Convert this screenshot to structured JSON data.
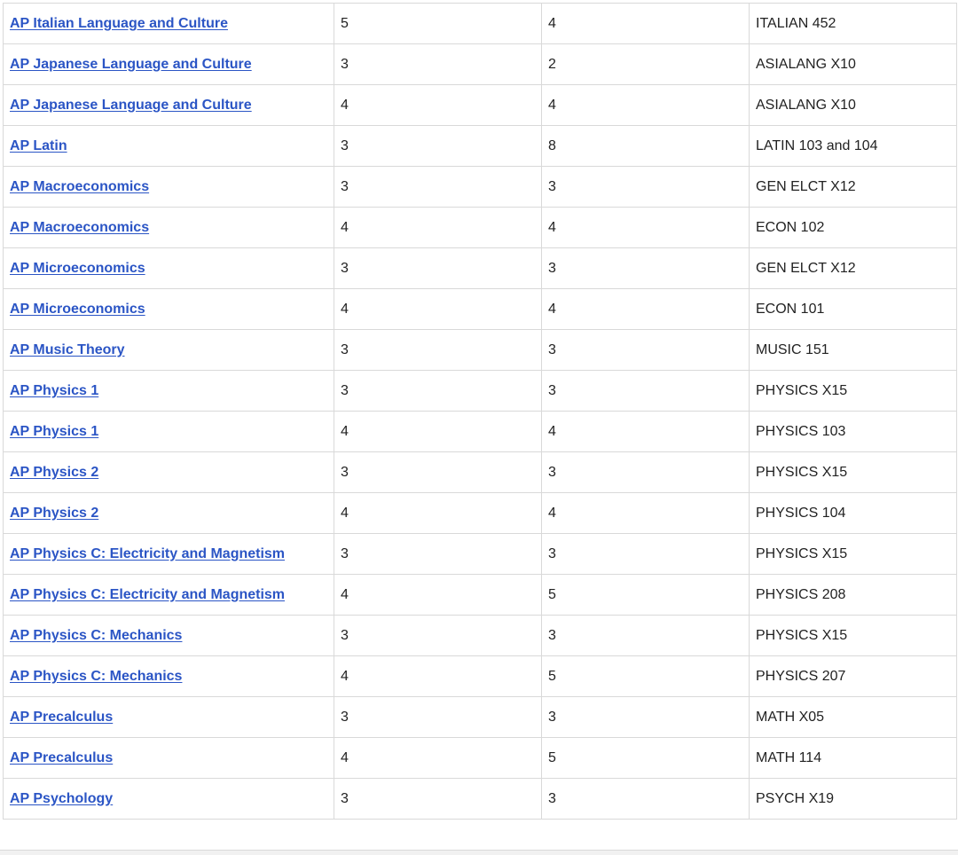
{
  "table": {
    "rows": [
      {
        "exam": "AP Italian Language and Culture",
        "score": "5",
        "units": "4",
        "equivalent": "ITALIAN 452"
      },
      {
        "exam": "AP Japanese Language and Culture",
        "score": "3",
        "units": "2",
        "equivalent": "ASIALANG X10"
      },
      {
        "exam": "AP Japanese Language and Culture",
        "score": "4",
        "units": "4",
        "equivalent": "ASIALANG X10"
      },
      {
        "exam": "AP Latin",
        "score": "3",
        "units": "8",
        "equivalent": "LATIN 103 and 104"
      },
      {
        "exam": "AP Macroeconomics",
        "score": "3",
        "units": "3",
        "equivalent": "GEN ELCT X12"
      },
      {
        "exam": "AP Macroeconomics",
        "score": "4",
        "units": "4",
        "equivalent": "ECON 102"
      },
      {
        "exam": "AP Microeconomics",
        "score": "3",
        "units": "3",
        "equivalent": "GEN ELCT X12"
      },
      {
        "exam": "AP Microeconomics",
        "score": "4",
        "units": "4",
        "equivalent": "ECON 101"
      },
      {
        "exam": "AP Music Theory",
        "score": "3",
        "units": "3",
        "equivalent": "MUSIC 151"
      },
      {
        "exam": "AP Physics 1",
        "score": "3",
        "units": "3",
        "equivalent": "PHYSICS X15"
      },
      {
        "exam": "AP Physics 1",
        "score": "4",
        "units": "4",
        "equivalent": "PHYSICS 103"
      },
      {
        "exam": "AP Physics 2",
        "score": "3",
        "units": "3",
        "equivalent": "PHYSICS X15"
      },
      {
        "exam": "AP Physics 2",
        "score": "4",
        "units": "4",
        "equivalent": "PHYSICS 104"
      },
      {
        "exam": "AP Physics C: Electricity and Magnetism",
        "score": "3",
        "units": "3",
        "equivalent": "PHYSICS X15"
      },
      {
        "exam": "AP Physics C: Electricity and Magnetism",
        "score": "4",
        "units": "5",
        "equivalent": "PHYSICS 208"
      },
      {
        "exam": "AP Physics C: Mechanics",
        "score": "3",
        "units": "3",
        "equivalent": "PHYSICS X15"
      },
      {
        "exam": "AP Physics C: Mechanics",
        "score": "4",
        "units": "5",
        "equivalent": "PHYSICS 207"
      },
      {
        "exam": "AP Precalculus",
        "score": "3",
        "units": "3",
        "equivalent": "MATH X05"
      },
      {
        "exam": "AP Precalculus",
        "score": "4",
        "units": "5",
        "equivalent": "MATH 114"
      },
      {
        "exam": "AP Psychology",
        "score": "3",
        "units": "3",
        "equivalent": "PSYCH X19"
      }
    ]
  },
  "colors": {
    "link": "#2b55c5",
    "border": "#d9d9d9",
    "text": "#222222"
  }
}
